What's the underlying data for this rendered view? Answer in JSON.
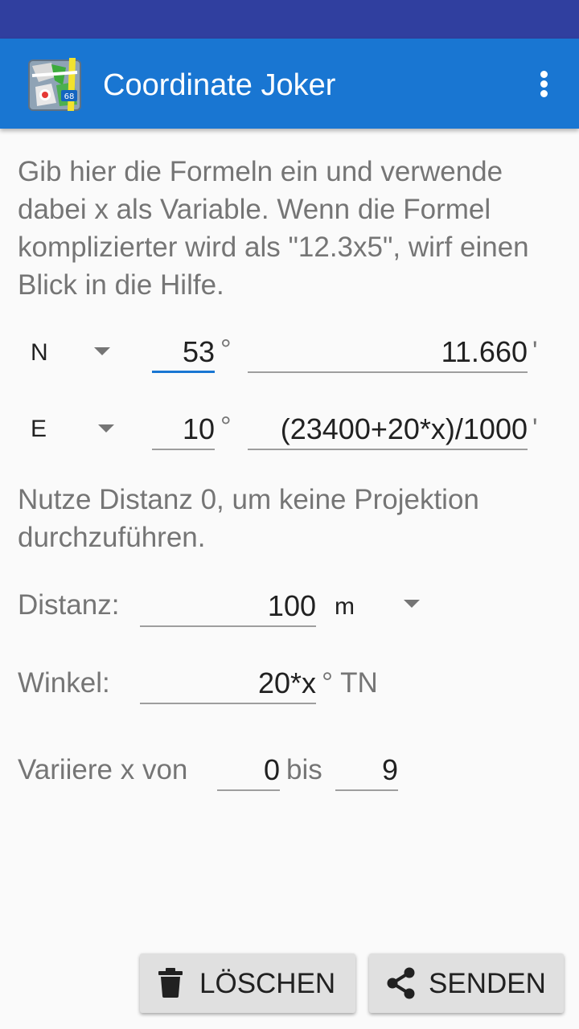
{
  "toolbar": {
    "title": "Coordinate Joker",
    "app_icon": "locus-map-icon",
    "overflow_icon": "more-vert-icon"
  },
  "intro_text": "Gib hier die Formeln ein und verwende dabei x als Variable. Wenn die Formel komplizierter wird als \"12.3x5\", wirf einen Blick in die Hilfe.",
  "latitude": {
    "hemisphere": "N",
    "degrees": "53",
    "degree_symbol": "°",
    "minutes": "11.660",
    "minute_symbol": "'"
  },
  "longitude": {
    "hemisphere": "E",
    "degrees": "10",
    "degree_symbol": "°",
    "minutes": "(23400+20*x)/1000",
    "minute_symbol": "'"
  },
  "hint_text": "Nutze Distanz 0, um keine Projektion durchzuführen.",
  "distance": {
    "label": "Distanz:",
    "value": "100",
    "unit": "m"
  },
  "angle": {
    "label": "Winkel:",
    "value": "20*x",
    "unit": "° TN"
  },
  "variation": {
    "label": "Variiere x von",
    "from": "0",
    "between": "bis",
    "to": "9"
  },
  "buttons": {
    "delete_label": "LÖSCHEN",
    "send_label": "SENDEN"
  },
  "colors": {
    "status_bar": "#303f9f",
    "app_bar": "#1976d2",
    "focus_underline": "#1976d2",
    "button_bg": "#e0e0e0"
  }
}
